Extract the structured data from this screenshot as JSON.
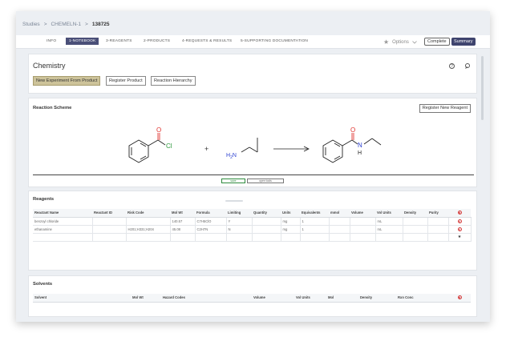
{
  "breadcrumb": {
    "root": "Studies",
    "study": "CHEMELN-1",
    "record": "138725",
    "sep": ">"
  },
  "tabs": [
    {
      "label": "INFO",
      "active": false
    },
    {
      "label": "1-NOTEBOOK",
      "active": true
    },
    {
      "label": "3-REAGENTS",
      "active": false
    },
    {
      "label": "2-PRODUCTS",
      "active": false
    },
    {
      "label": "4-REQUESTS & RESULTS",
      "active": false
    },
    {
      "label": "5-SUPPORTING DOCUMENTATION",
      "active": false
    }
  ],
  "header_actions": {
    "options_label": "Options",
    "complete_label": "Complete",
    "summary_label": "Summary",
    "star_icon": "star-icon",
    "options_icon": "chevron-down-icon"
  },
  "chemistry": {
    "title": "Chemistry",
    "buttons": [
      "New Experiment From Product",
      "Register Product",
      "Reaction Hierarchy"
    ],
    "help_icon": "help-icon",
    "search_icon": "search-icon"
  },
  "reaction": {
    "title": "Reaction Scheme",
    "register_label": "Register New Reagent",
    "atoms": {
      "o": "O",
      "cl": "Cl",
      "n": "N",
      "h": "H",
      "h2n_h": "H",
      "h2n_2": "2",
      "h2n_n": "N"
    },
    "plus": "+",
    "save_label": "save",
    "edit_label": "open tools"
  },
  "reagents": {
    "title": "Reagents",
    "columns": [
      "Reactant Name",
      "Reactant ID",
      "Risk Code",
      "Mol Wt",
      "Formula",
      "Limiting",
      "Quantity",
      "Units",
      "Equivalents",
      "mmol",
      "Volume",
      "Vol Units",
      "Density",
      "Purity"
    ],
    "rows": [
      [
        "benzoyl chloride",
        "",
        "",
        "140.57",
        "C7H5ClO",
        "Y",
        "",
        "mg",
        "1",
        "",
        "",
        "mL",
        "",
        ""
      ],
      [
        "ethanamine",
        "",
        "H201;H331;H204",
        "45.08",
        "C2H7N",
        "N",
        "",
        "mg",
        "1",
        "",
        "",
        "mL",
        "",
        ""
      ]
    ],
    "delete_icon": "delete-icon",
    "add_icon": "add-row-icon"
  },
  "solvents": {
    "title": "Solvents",
    "columns": [
      "Solvent",
      "Mol Wt",
      "Hazard Codes",
      "Volume",
      "Vol Units",
      "Mol",
      "Density",
      "Rxn Conc"
    ],
    "delete_icon": "delete-icon"
  },
  "colors": {
    "accent": "#4a4f78",
    "primary_btn": "#cdc39a",
    "oxygen": "#e0332f",
    "chlorine": "#2e9a3e",
    "nitrogen": "#2b3fd0",
    "delete": "#d43a3a"
  }
}
